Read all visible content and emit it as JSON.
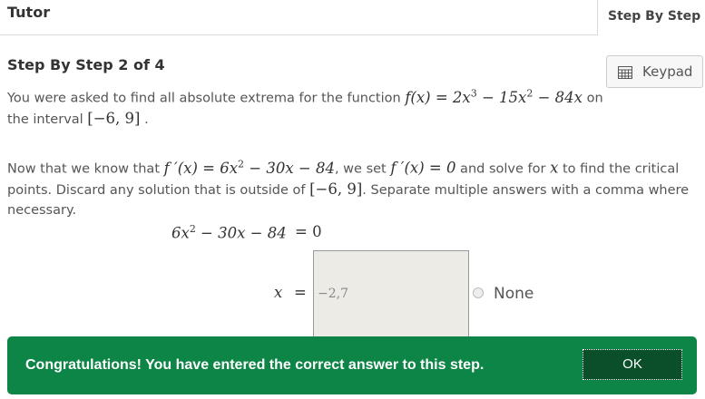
{
  "header": {
    "title": "Tutor",
    "tab_label": "Step By Step"
  },
  "step": {
    "title": "Step By Step 2 of 4",
    "keypad_label": "Keypad"
  },
  "intro": {
    "pre": "You were asked to find all absolute extrema for the function",
    "func_lhs": "f(x) = 2x",
    "func_exp1": "3",
    "func_mid": " − 15x",
    "func_exp2": "2",
    "func_end": " − 84x",
    "post": " on",
    "interval_pre": "the interval ",
    "interval": "[−6, 9]",
    "interval_post": " ."
  },
  "instruction": {
    "pre": "Now that we know that ",
    "fprime": "f ′(x) = 6x",
    "fprime_exp": "2",
    "fprime_rest": " − 30x − 84",
    "mid": ", we set ",
    "set_eq": "f ′(x) = 0",
    "mid2": " and solve for ",
    "var": "x",
    "post1": " to find the critical",
    "line2_pre": "points. Discard any solution that is outside of ",
    "interval": "[−6, 9]",
    "line2_post": ". Separate multiple answers with a comma where",
    "line3": "necessary."
  },
  "equation": {
    "lhs_a": "6x",
    "lhs_exp": "2",
    "lhs_b": " − 30x − 84",
    "rhs": "= 0"
  },
  "answer": {
    "var_label": "x",
    "eq": "=",
    "value": "−2,7"
  },
  "none_option": {
    "label": "None"
  },
  "feedback": {
    "message": "Congratulations! You have entered the correct answer to this step.",
    "ok_label": "OK",
    "color": "#0d8546"
  }
}
